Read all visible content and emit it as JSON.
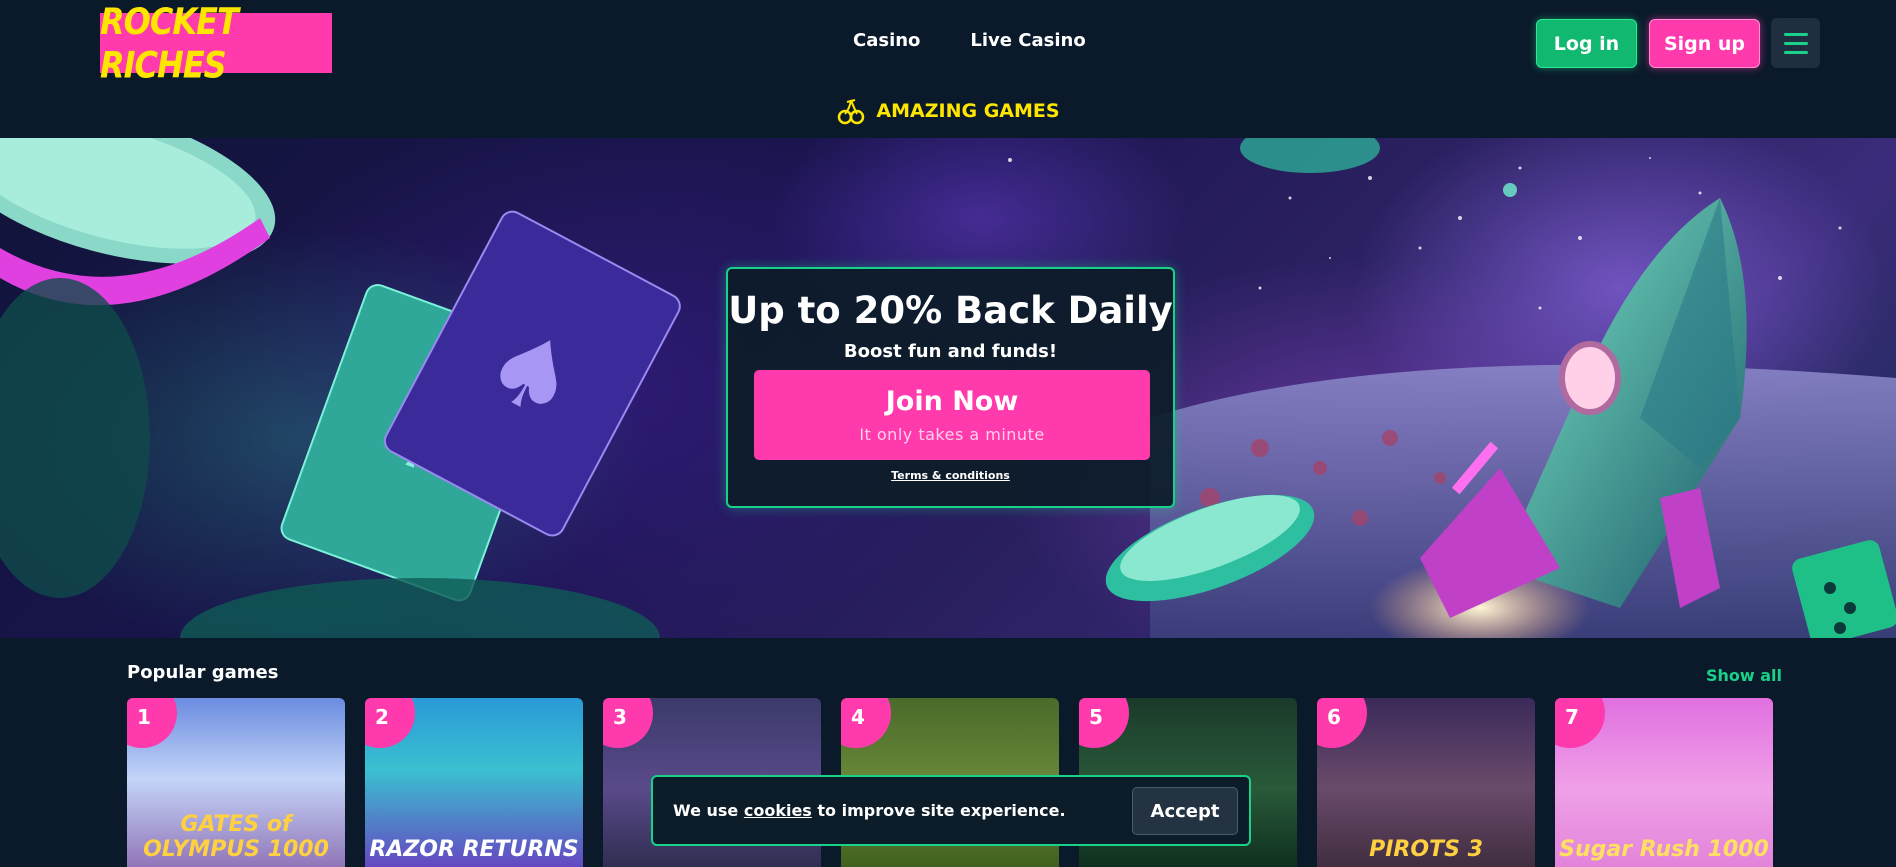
{
  "brand": {
    "logo_text": "ROCKET RICHES"
  },
  "nav": {
    "items": [
      {
        "label": "Casino"
      },
      {
        "label": "Live Casino"
      }
    ]
  },
  "header": {
    "login_label": "Log in",
    "signup_label": "Sign up",
    "menu_icon": "hamburger-icon"
  },
  "strip": {
    "label": "AMAZING GAMES",
    "icon": "cherry-icon"
  },
  "promo": {
    "title": "Up to 20% Back Daily",
    "subtitle": "Boost fun and funds!",
    "cta_label": "Join Now",
    "cta_sub": "It only takes a minute",
    "terms_label": "Terms & conditions"
  },
  "popular": {
    "title": "Popular games",
    "show_all_label": "Show all",
    "games": [
      {
        "rank": "1",
        "title": "GATES of OLYMPUS 1000"
      },
      {
        "rank": "2",
        "title": "RAZOR RETURNS"
      },
      {
        "rank": "3",
        "title": ""
      },
      {
        "rank": "4",
        "title": ""
      },
      {
        "rank": "5",
        "title": ""
      },
      {
        "rank": "6",
        "title": "PIROTS 3"
      },
      {
        "rank": "7",
        "title": "Sugar Rush 1000"
      }
    ]
  },
  "cookie": {
    "text_before": "We use ",
    "link_label": "cookies",
    "text_after": " to improve site experience.",
    "accept_label": "Accept"
  },
  "colors": {
    "accent_pink": "#ff3aac",
    "accent_green": "#19d28a",
    "logo_yellow": "#ffe600",
    "background": "#0b1a2b"
  }
}
